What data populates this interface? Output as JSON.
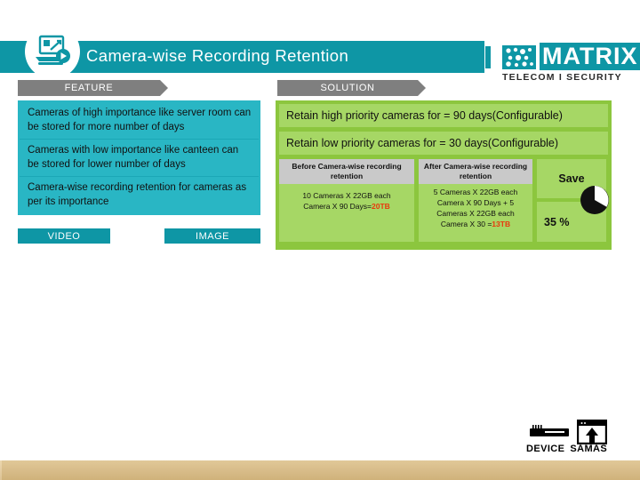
{
  "header": {
    "title": "Camera-wise Recording Retention",
    "icon": "presentation-video-icon",
    "band_color": "#0e96a5"
  },
  "logo": {
    "name": "MATRIX",
    "tagline": "TELECOM I SECURITY",
    "color": "#0e96a5"
  },
  "tabs": {
    "feature": "FEATURE",
    "solution": "SOLUTION"
  },
  "feature": {
    "accent_color": "#29b6c4",
    "items": [
      "Cameras of high importance like server room can be stored for more number of days",
      "Cameras with low importance like canteen can be stored for lower number of days",
      "Camera-wise recording retention for cameras as per its importance"
    ],
    "chips": {
      "video": "VIDEO",
      "image": "IMAGE"
    }
  },
  "solution": {
    "accent_color": "#8cc63e",
    "lines": [
      "Retain high priority cameras for = 90 days(Configurable)",
      "Retain low priority cameras for = 30 days(Configurable)"
    ],
    "stats": {
      "before": {
        "heading": "Before Camera-wise recording retention",
        "line1": "10 Cameras X 22GB each",
        "line2_prefix": "Camera X 90 Days=",
        "line2_highlight": "20TB"
      },
      "after": {
        "heading": "After Camera-wise recording retention",
        "line1": "5 Cameras X 22GB each",
        "line2": "Camera X 90 Days + 5",
        "line3": "Cameras X 22GB each",
        "line4_prefix": "Camera X 30 =",
        "line4_highlight": "13TB"
      },
      "save": {
        "label": "Save",
        "percent": "35 %",
        "icon": "pie-chart-icon"
      }
    },
    "highlight_color": "#e8380d"
  },
  "bottom": {
    "device_label": "DEVICE",
    "samas_label": "SAMAS",
    "device_icon": "nvr-device-icon",
    "samas_icon": "browser-upload-icon"
  }
}
